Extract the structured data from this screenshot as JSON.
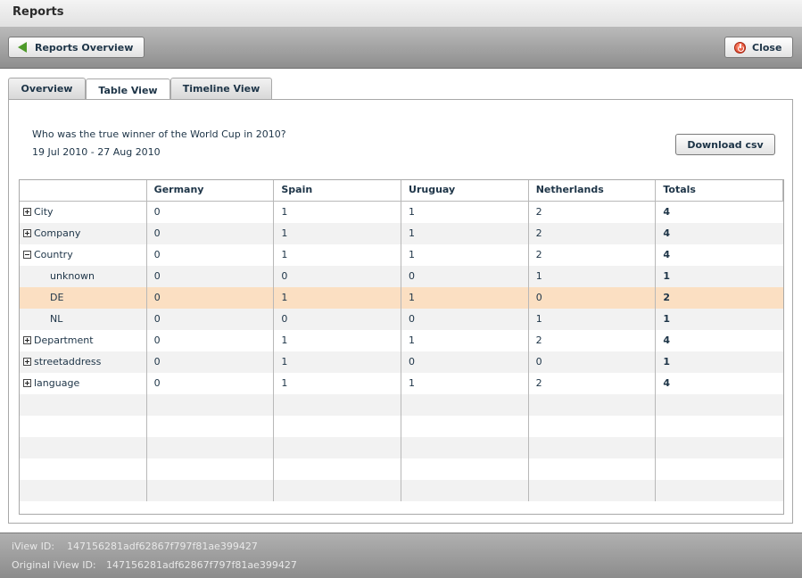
{
  "window": {
    "title": "Reports"
  },
  "toolbar": {
    "overview_label": "Reports Overview",
    "close_label": "Close"
  },
  "tabs": [
    {
      "label": "Overview",
      "active": false
    },
    {
      "label": "Table View",
      "active": true
    },
    {
      "label": "Timeline View",
      "active": false
    }
  ],
  "report": {
    "question": "Who was the true winner of the World Cup in 2010?",
    "date_range": "19 Jul 2010 - 27 Aug 2010",
    "download_label": "Download csv"
  },
  "table": {
    "columns": [
      "",
      "Germany",
      "Spain",
      "Uruguay",
      "Netherlands",
      "Totals"
    ],
    "rows": [
      {
        "label": "City",
        "expander": "plus",
        "level": 0,
        "values": [
          "0",
          "1",
          "1",
          "2"
        ],
        "total": "4"
      },
      {
        "label": "Company",
        "expander": "plus",
        "level": 0,
        "values": [
          "0",
          "1",
          "1",
          "2"
        ],
        "total": "4"
      },
      {
        "label": "Country",
        "expander": "minus",
        "level": 0,
        "values": [
          "0",
          "1",
          "1",
          "2"
        ],
        "total": "4"
      },
      {
        "label": "unknown",
        "expander": "",
        "level": 1,
        "values": [
          "0",
          "0",
          "0",
          "1"
        ],
        "total": "1"
      },
      {
        "label": "DE",
        "expander": "",
        "level": 1,
        "values": [
          "0",
          "1",
          "1",
          "0"
        ],
        "total": "2",
        "selected": true
      },
      {
        "label": "NL",
        "expander": "",
        "level": 1,
        "values": [
          "0",
          "0",
          "0",
          "1"
        ],
        "total": "1"
      },
      {
        "label": "Department",
        "expander": "plus",
        "level": 0,
        "values": [
          "0",
          "1",
          "1",
          "2"
        ],
        "total": "4"
      },
      {
        "label": "streetaddress",
        "expander": "plus",
        "level": 0,
        "values": [
          "0",
          "1",
          "0",
          "0"
        ],
        "total": "1"
      },
      {
        "label": "language",
        "expander": "plus",
        "level": 0,
        "values": [
          "0",
          "1",
          "1",
          "2"
        ],
        "total": "4"
      }
    ]
  },
  "footer": {
    "iview_label": "iView ID:",
    "iview_id": "147156281adf62867f797f81ae399427",
    "original_label": "Original iView ID:",
    "original_id": "147156281adf62867f797f81ae399427"
  }
}
